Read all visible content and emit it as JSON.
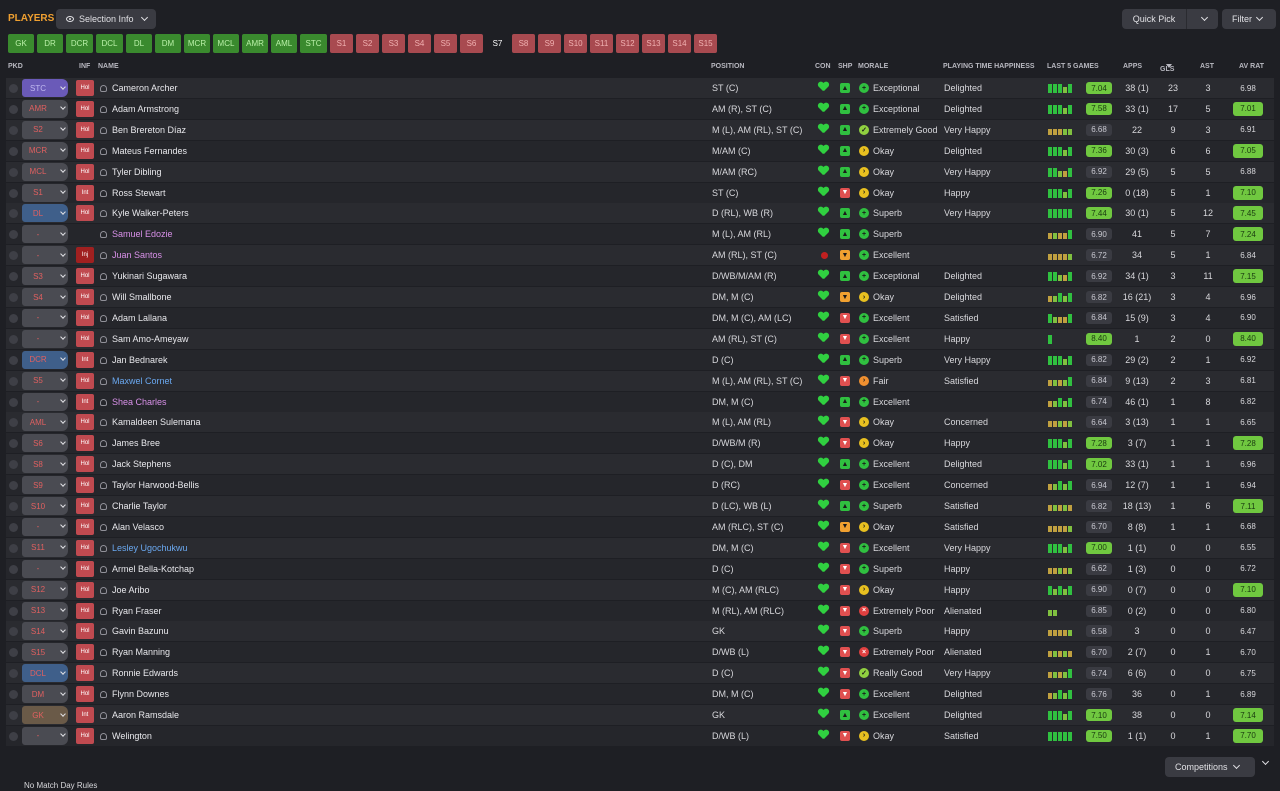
{
  "header": {
    "title": "PLAYERS",
    "selection_info": "Selection Info",
    "quick_pick": "Quick Pick",
    "filter": "Filter"
  },
  "position_tabs": [
    {
      "label": "GK",
      "state": "filled"
    },
    {
      "label": "DR",
      "state": "filled"
    },
    {
      "label": "DCR",
      "state": "filled"
    },
    {
      "label": "DCL",
      "state": "filled"
    },
    {
      "label": "DL",
      "state": "filled"
    },
    {
      "label": "DM",
      "state": "filled"
    },
    {
      "label": "MCR",
      "state": "filled"
    },
    {
      "label": "MCL",
      "state": "filled"
    },
    {
      "label": "AMR",
      "state": "filled"
    },
    {
      "label": "AML",
      "state": "filled"
    },
    {
      "label": "STC",
      "state": "filled"
    },
    {
      "label": "S1",
      "state": "sub"
    },
    {
      "label": "S2",
      "state": "sub"
    },
    {
      "label": "S3",
      "state": "sub"
    },
    {
      "label": "S4",
      "state": "sub"
    },
    {
      "label": "S5",
      "state": "sub"
    },
    {
      "label": "S6",
      "state": "sub"
    },
    {
      "label": "S7",
      "state": "active"
    },
    {
      "label": "S8",
      "state": "sub"
    },
    {
      "label": "S9",
      "state": "sub"
    },
    {
      "label": "S10",
      "state": "sub"
    },
    {
      "label": "S11",
      "state": "sub"
    },
    {
      "label": "S12",
      "state": "sub"
    },
    {
      "label": "S13",
      "state": "sub"
    },
    {
      "label": "S14",
      "state": "sub"
    },
    {
      "label": "S15",
      "state": "sub"
    }
  ],
  "columns": {
    "pkd": "PKD",
    "inf": "INF",
    "name": "NAME",
    "position": "POSITION",
    "con": "CON",
    "shp": "SHP",
    "morale": "MORALE",
    "pth": "PLAYING TIME HAPPINESS",
    "last5": "LAST 5 GAMES",
    "apps": "APPS",
    "gls": "GLS",
    "ast": "AST",
    "avrat": "AV RAT"
  },
  "players": [
    {
      "pkd": "STC",
      "pkd_color": "pu",
      "inf": "Hol",
      "name": "Cameron Archer",
      "name_color": "",
      "position": "ST (C)",
      "shp": "g",
      "morale_icon": "g",
      "morale": "Exceptional",
      "pth": "Delighted",
      "form": "ggglg",
      "last5": "7.04",
      "last5_hi": true,
      "apps": "38 (1)",
      "gls": "23",
      "ast": "3",
      "avrat": "6.98",
      "avrat_hi": false
    },
    {
      "pkd": "AMR",
      "pkd_color": "gr",
      "inf": "Hol",
      "name": "Adam Armstrong",
      "name_color": "",
      "position": "AM (R), ST (C)",
      "shp": "g",
      "morale_icon": "g",
      "morale": "Exceptional",
      "pth": "Delighted",
      "form": "ggglg",
      "last5": "7.58",
      "last5_hi": true,
      "apps": "33 (1)",
      "gls": "17",
      "ast": "5",
      "avrat": "7.01",
      "avrat_hi": true
    },
    {
      "pkd": "S2",
      "pkd_color": "gr2",
      "inf": "Hol",
      "name": "Ben Brereton Díaz",
      "name_color": "",
      "position": "M (L), AM (RL), ST (C)",
      "shp": "g",
      "morale_icon": "lg",
      "morale": "Extremely Good",
      "pth": "Very Happy",
      "form": "yyyll",
      "last5": "6.68",
      "last5_hi": false,
      "apps": "22",
      "gls": "9",
      "ast": "3",
      "avrat": "6.91",
      "avrat_hi": false
    },
    {
      "pkd": "MCR",
      "pkd_color": "gr2",
      "inf": "Hol",
      "name": "Mateus Fernandes",
      "name_color": "",
      "position": "M/AM (C)",
      "shp": "g",
      "morale_icon": "y",
      "morale": "Okay",
      "pth": "Delighted",
      "form": "ggglg",
      "last5": "7.36",
      "last5_hi": true,
      "apps": "30 (3)",
      "gls": "6",
      "ast": "6",
      "avrat": "7.05",
      "avrat_hi": true
    },
    {
      "pkd": "MCL",
      "pkd_color": "gr2",
      "inf": "Hol",
      "name": "Tyler Dibling",
      "name_color": "",
      "position": "M/AM (RC)",
      "shp": "g",
      "morale_icon": "y",
      "morale": "Okay",
      "pth": "Very Happy",
      "form": "gglyg",
      "last5": "6.92",
      "last5_hi": false,
      "apps": "29 (5)",
      "gls": "5",
      "ast": "5",
      "avrat": "6.88",
      "avrat_hi": false
    },
    {
      "pkd": "S1",
      "pkd_color": "gr2",
      "inf": "Int",
      "name": "Ross Stewart",
      "name_color": "",
      "position": "ST (C)",
      "shp": "r",
      "morale_icon": "y",
      "morale": "Okay",
      "pth": "Happy",
      "form": "ggglg",
      "last5": "7.26",
      "last5_hi": true,
      "apps": "0 (18)",
      "gls": "5",
      "ast": "1",
      "avrat": "7.10",
      "avrat_hi": true
    },
    {
      "pkd": "DL",
      "pkd_color": "bl",
      "inf": "Hol",
      "name": "Kyle Walker-Peters",
      "name_color": "",
      "position": "D (RL), WB (R)",
      "shp": "g",
      "morale_icon": "g",
      "morale": "Superb",
      "pth": "Very Happy",
      "form": "ggggg",
      "last5": "7.44",
      "last5_hi": true,
      "apps": "30 (1)",
      "gls": "5",
      "ast": "12",
      "avrat": "7.45",
      "avrat_hi": true
    },
    {
      "pkd": "-",
      "pkd_color": "gr",
      "inf": "",
      "name": "Samuel Edozie",
      "name_color": "pk",
      "position": "M (L), AM (RL)",
      "shp": "g",
      "morale_icon": "g",
      "morale": "Superb",
      "pth": "",
      "form": "ylyyg",
      "last5": "6.90",
      "last5_hi": false,
      "apps": "41",
      "gls": "5",
      "ast": "7",
      "avrat": "7.24",
      "avrat_hi": true
    },
    {
      "pkd": "-",
      "pkd_color": "gr",
      "inf": "Inj",
      "name": "Juan Santos",
      "name_color": "pk",
      "position": "AM (RL), ST (C)",
      "shp": "o",
      "morale_icon": "g",
      "morale": "Excellent",
      "pth": "",
      "form": "yyyyl",
      "last5": "6.72",
      "last5_hi": false,
      "apps": "34",
      "gls": "5",
      "ast": "1",
      "avrat": "6.84",
      "avrat_hi": false,
      "injured": true
    },
    {
      "pkd": "S3",
      "pkd_color": "gr2",
      "inf": "Hol",
      "name": "Yukinari Sugawara",
      "name_color": "",
      "position": "D/WB/M/AM (R)",
      "shp": "g",
      "morale_icon": "g",
      "morale": "Exceptional",
      "pth": "Delighted",
      "form": "gglyg",
      "last5": "6.92",
      "last5_hi": false,
      "apps": "34 (1)",
      "gls": "3",
      "ast": "11",
      "avrat": "7.15",
      "avrat_hi": true
    },
    {
      "pkd": "S4",
      "pkd_color": "gr2",
      "inf": "Hol",
      "name": "Will Smallbone",
      "name_color": "",
      "position": "DM, M (C)",
      "shp": "o",
      "morale_icon": "y",
      "morale": "Okay",
      "pth": "Delighted",
      "form": "ylglg",
      "last5": "6.82",
      "last5_hi": false,
      "apps": "16 (21)",
      "gls": "3",
      "ast": "4",
      "avrat": "6.96",
      "avrat_hi": false
    },
    {
      "pkd": "-",
      "pkd_color": "gr",
      "inf": "Hol",
      "name": "Adam Lallana",
      "name_color": "",
      "position": "DM, M (C), AM (LC)",
      "shp": "r",
      "morale_icon": "g",
      "morale": "Excellent",
      "pth": "Satisfied",
      "form": "glyyg",
      "last5": "6.84",
      "last5_hi": false,
      "apps": "15 (9)",
      "gls": "3",
      "ast": "4",
      "avrat": "6.90",
      "avrat_hi": false
    },
    {
      "pkd": "-",
      "pkd_color": "gr",
      "inf": "Hol",
      "name": "Sam Amo-Ameyaw",
      "name_color": "",
      "position": "AM (RL), ST (C)",
      "shp": "r",
      "morale_icon": "g",
      "morale": "Excellent",
      "pth": "Happy",
      "form": "g",
      "last5": "8.40",
      "last5_hi": true,
      "apps": "1",
      "gls": "2",
      "ast": "0",
      "avrat": "8.40",
      "avrat_hi": true
    },
    {
      "pkd": "DCR",
      "pkd_color": "bl",
      "inf": "Int",
      "name": "Jan Bednarek",
      "name_color": "",
      "position": "D (C)",
      "shp": "g",
      "morale_icon": "g",
      "morale": "Superb",
      "pth": "Very Happy",
      "form": "ggglg",
      "last5": "6.82",
      "last5_hi": false,
      "apps": "29 (2)",
      "gls": "2",
      "ast": "1",
      "avrat": "6.92",
      "avrat_hi": false
    },
    {
      "pkd": "S5",
      "pkd_color": "gr2",
      "inf": "Hol",
      "name": "Maxwel Cornet",
      "name_color": "bl",
      "position": "M (L), AM (RL), ST (C)",
      "shp": "r",
      "morale_icon": "o",
      "morale": "Fair",
      "pth": "Satisfied",
      "form": "ylylg",
      "last5": "6.84",
      "last5_hi": false,
      "apps": "9 (13)",
      "gls": "2",
      "ast": "3",
      "avrat": "6.81",
      "avrat_hi": false
    },
    {
      "pkd": "-",
      "pkd_color": "gr",
      "inf": "Int",
      "name": "Shea Charles",
      "name_color": "pk",
      "position": "DM, M (C)",
      "shp": "g",
      "morale_icon": "g",
      "morale": "Excellent",
      "pth": "",
      "form": "ylglg",
      "last5": "6.74",
      "last5_hi": false,
      "apps": "46 (1)",
      "gls": "1",
      "ast": "8",
      "avrat": "6.82",
      "avrat_hi": false
    },
    {
      "pkd": "AML",
      "pkd_color": "gr",
      "inf": "Hol",
      "name": "Kamaldeen Sulemana",
      "name_color": "",
      "position": "M (L), AM (RL)",
      "shp": "r",
      "morale_icon": "y",
      "morale": "Okay",
      "pth": "Concerned",
      "form": "yylyl",
      "last5": "6.64",
      "last5_hi": false,
      "apps": "3 (13)",
      "gls": "1",
      "ast": "1",
      "avrat": "6.65",
      "avrat_hi": false
    },
    {
      "pkd": "S6",
      "pkd_color": "gr2",
      "inf": "Hol",
      "name": "James Bree",
      "name_color": "",
      "position": "D/WB/M (R)",
      "shp": "r",
      "morale_icon": "y",
      "morale": "Okay",
      "pth": "Happy",
      "form": "ggglg",
      "last5": "7.28",
      "last5_hi": true,
      "apps": "3 (7)",
      "gls": "1",
      "ast": "1",
      "avrat": "7.28",
      "avrat_hi": true
    },
    {
      "pkd": "S8",
      "pkd_color": "gr2",
      "inf": "Hol",
      "name": "Jack Stephens",
      "name_color": "",
      "position": "D (C), DM",
      "shp": "g",
      "morale_icon": "g",
      "morale": "Excellent",
      "pth": "Delighted",
      "form": "ggglg",
      "last5": "7.02",
      "last5_hi": true,
      "apps": "33 (1)",
      "gls": "1",
      "ast": "1",
      "avrat": "6.96",
      "avrat_hi": false
    },
    {
      "pkd": "S9",
      "pkd_color": "gr2",
      "inf": "Hol",
      "name": "Taylor Harwood-Bellis",
      "name_color": "",
      "position": "D (RC)",
      "shp": "r",
      "morale_icon": "g",
      "morale": "Excellent",
      "pth": "Concerned",
      "form": "ylglg",
      "last5": "6.94",
      "last5_hi": false,
      "apps": "12 (7)",
      "gls": "1",
      "ast": "1",
      "avrat": "6.94",
      "avrat_hi": false
    },
    {
      "pkd": "S10",
      "pkd_color": "gr2",
      "inf": "Hol",
      "name": "Charlie Taylor",
      "name_color": "",
      "position": "D (LC), WB (L)",
      "shp": "g",
      "morale_icon": "g",
      "morale": "Superb",
      "pth": "Satisfied",
      "form": "ylyly",
      "last5": "6.82",
      "last5_hi": false,
      "apps": "18 (13)",
      "gls": "1",
      "ast": "6",
      "avrat": "7.11",
      "avrat_hi": true
    },
    {
      "pkd": "-",
      "pkd_color": "gr",
      "inf": "Hol",
      "name": "Alan Velasco",
      "name_color": "",
      "position": "AM (RLC), ST (C)",
      "shp": "o",
      "morale_icon": "y",
      "morale": "Okay",
      "pth": "Satisfied",
      "form": "yyyyl",
      "last5": "6.70",
      "last5_hi": false,
      "apps": "8 (8)",
      "gls": "1",
      "ast": "1",
      "avrat": "6.68",
      "avrat_hi": false
    },
    {
      "pkd": "S11",
      "pkd_color": "gr2",
      "inf": "Hol",
      "name": "Lesley Ugochukwu",
      "name_color": "bl",
      "position": "DM, M (C)",
      "shp": "r",
      "morale_icon": "g",
      "morale": "Excellent",
      "pth": "Very Happy",
      "form": "ggglg",
      "last5": "7.00",
      "last5_hi": true,
      "apps": "1 (1)",
      "gls": "0",
      "ast": "0",
      "avrat": "6.55",
      "avrat_hi": false
    },
    {
      "pkd": "-",
      "pkd_color": "gr",
      "inf": "Hol",
      "name": "Armel Bella-Kotchap",
      "name_color": "",
      "position": "D (C)",
      "shp": "r",
      "morale_icon": "g",
      "morale": "Superb",
      "pth": "Happy",
      "form": "yylyl",
      "last5": "6.62",
      "last5_hi": false,
      "apps": "1 (3)",
      "gls": "0",
      "ast": "0",
      "avrat": "6.72",
      "avrat_hi": false
    },
    {
      "pkd": "S12",
      "pkd_color": "gr2",
      "inf": "Hol",
      "name": "Joe Aribo",
      "name_color": "",
      "position": "M (C), AM (RLC)",
      "shp": "r",
      "morale_icon": "y",
      "morale": "Okay",
      "pth": "Happy",
      "form": "glglg",
      "last5": "6.90",
      "last5_hi": false,
      "apps": "0 (7)",
      "gls": "0",
      "ast": "0",
      "avrat": "7.10",
      "avrat_hi": true
    },
    {
      "pkd": "S13",
      "pkd_color": "gr2",
      "inf": "Hol",
      "name": "Ryan Fraser",
      "name_color": "",
      "position": "M (RL), AM (RLC)",
      "shp": "r",
      "morale_icon": "r",
      "morale": "Extremely Poor",
      "pth": "Alienated",
      "form": "ll",
      "last5": "6.85",
      "last5_hi": false,
      "apps": "0 (2)",
      "gls": "0",
      "ast": "0",
      "avrat": "6.80",
      "avrat_hi": false
    },
    {
      "pkd": "S14",
      "pkd_color": "gr2",
      "inf": "Hol",
      "name": "Gavin Bazunu",
      "name_color": "",
      "position": "GK",
      "shp": "r",
      "morale_icon": "g",
      "morale": "Superb",
      "pth": "Happy",
      "form": "yyyyl",
      "last5": "6.58",
      "last5_hi": false,
      "apps": "3",
      "gls": "0",
      "ast": "0",
      "avrat": "6.47",
      "avrat_hi": false
    },
    {
      "pkd": "S15",
      "pkd_color": "gr2",
      "inf": "Hol",
      "name": "Ryan Manning",
      "name_color": "",
      "position": "D/WB (L)",
      "shp": "r",
      "morale_icon": "r",
      "morale": "Extremely Poor",
      "pth": "Alienated",
      "form": "ylyly",
      "last5": "6.70",
      "last5_hi": false,
      "apps": "2 (7)",
      "gls": "0",
      "ast": "1",
      "avrat": "6.70",
      "avrat_hi": false
    },
    {
      "pkd": "DCL",
      "pkd_color": "bl",
      "inf": "Hol",
      "name": "Ronnie Edwards",
      "name_color": "",
      "position": "D (C)",
      "shp": "r",
      "morale_icon": "lg",
      "morale": "Really Good",
      "pth": "Very Happy",
      "form": "ylylg",
      "last5": "6.74",
      "last5_hi": false,
      "apps": "6 (6)",
      "gls": "0",
      "ast": "0",
      "avrat": "6.75",
      "avrat_hi": false
    },
    {
      "pkd": "DM",
      "pkd_color": "gr",
      "inf": "Hol",
      "name": "Flynn Downes",
      "name_color": "",
      "position": "DM, M (C)",
      "shp": "r",
      "morale_icon": "g",
      "morale": "Excellent",
      "pth": "Delighted",
      "form": "ylglg",
      "last5": "6.76",
      "last5_hi": false,
      "apps": "36",
      "gls": "0",
      "ast": "1",
      "avrat": "6.89",
      "avrat_hi": false
    },
    {
      "pkd": "GK",
      "pkd_color": "br",
      "inf": "Int",
      "name": "Aaron Ramsdale",
      "name_color": "",
      "position": "GK",
      "shp": "g",
      "morale_icon": "g",
      "morale": "Excellent",
      "pth": "Delighted",
      "form": "ggglg",
      "last5": "7.10",
      "last5_hi": true,
      "apps": "38",
      "gls": "0",
      "ast": "0",
      "avrat": "7.14",
      "avrat_hi": true
    },
    {
      "pkd": "-",
      "pkd_color": "gr",
      "inf": "Hol",
      "name": "Welington",
      "name_color": "",
      "position": "D/WB (L)",
      "shp": "r",
      "morale_icon": "y",
      "morale": "Okay",
      "pth": "Satisfied",
      "form": "ggggg",
      "last5": "7.50",
      "last5_hi": true,
      "apps": "1 (1)",
      "gls": "0",
      "ast": "1",
      "avrat": "7.70",
      "avrat_hi": true
    }
  ],
  "footer": {
    "match_day_rules": "No Match Day Rules",
    "competitions": "Competitions"
  }
}
